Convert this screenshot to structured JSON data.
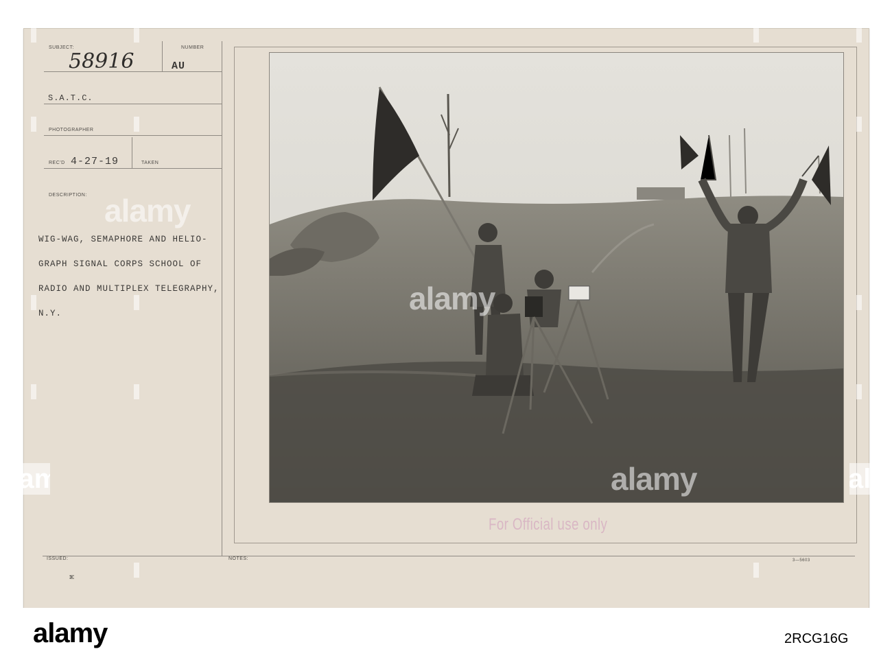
{
  "card": {
    "subject_label": "SUBJECT:",
    "subject_number_handwritten": "58916",
    "number_label": "NUMBER",
    "number_value": "AU",
    "unit": "S.A.T.C.",
    "photographer_label": "PHOTOGRAPHER",
    "recd_label": "REC'D",
    "recd_date": "4-27-19",
    "taken_label": "TAKEN",
    "description_label": "DESCRIPTION:",
    "description_lines": [
      "WIG-WAG, SEMAPHORE AND HELIO-",
      "GRAPH SIGNAL CORPS SCHOOL OF",
      "RADIO AND MULTIPLEX TELEGRAPHY,",
      "N.Y."
    ],
    "issued_label": "ISSUED:",
    "issued_mark": "M",
    "notes_label": "NOTES:",
    "form_number": "3—5603",
    "stamp": "For Official use only"
  },
  "watermark": {
    "text": "alamy"
  },
  "footer": {
    "logo": "alamy",
    "image_id": "2RCG16G"
  }
}
